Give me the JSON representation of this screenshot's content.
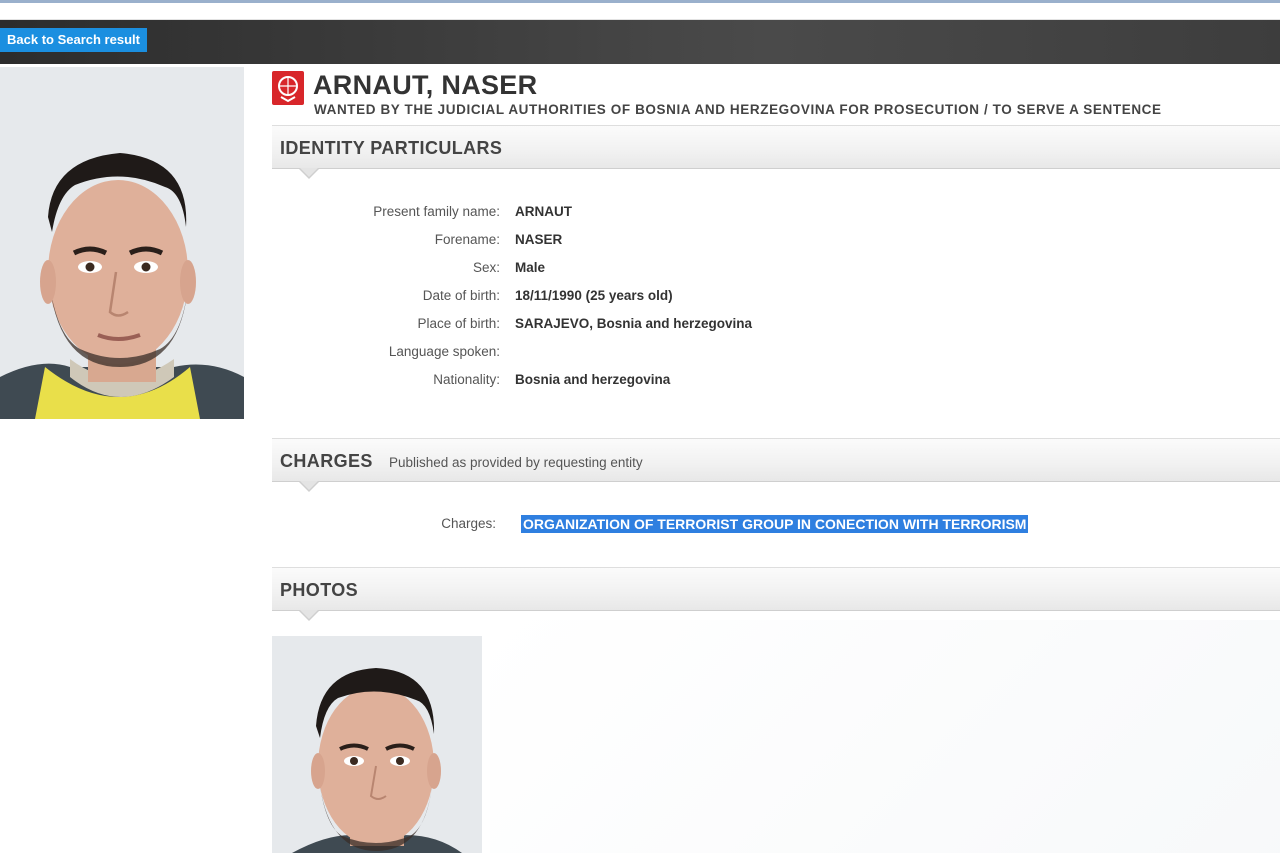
{
  "nav": {
    "back_label": "Back to Search result"
  },
  "person": {
    "name": "ARNAUT, NASER",
    "wanted_by": "WANTED BY THE JUDICIAL AUTHORITIES OF BOSNIA AND HERZEGOVINA FOR PROSECUTION / TO SERVE A SENTENCE"
  },
  "identity": {
    "title": "IDENTITY PARTICULARS",
    "rows": [
      {
        "label": "Present family name:",
        "value": "ARNAUT"
      },
      {
        "label": "Forename:",
        "value": "NASER"
      },
      {
        "label": "Sex:",
        "value": "Male"
      },
      {
        "label": "Date of birth:",
        "value": "18/11/1990 (25 years old)"
      },
      {
        "label": "Place of birth:",
        "value": "SARAJEVO, Bosnia and herzegovina"
      },
      {
        "label": "Language spoken:",
        "value": ""
      },
      {
        "label": "Nationality:",
        "value": "Bosnia and herzegovina"
      }
    ]
  },
  "charges": {
    "title": "CHARGES",
    "subtitle": "Published as provided by requesting entity",
    "label": "Charges:",
    "value": "ORGANIZATION OF TERRORIST GROUP IN CONECTION WITH TERRORISM"
  },
  "photos": {
    "title": "PHOTOS"
  },
  "colors": {
    "accent_blue": "#1b8fe0",
    "selection_blue": "#2f7fe0",
    "logo_red": "#d8262a",
    "nav_dark": "#3b3b3b"
  },
  "icons": {
    "logo": "interpol-red-notice-icon"
  }
}
